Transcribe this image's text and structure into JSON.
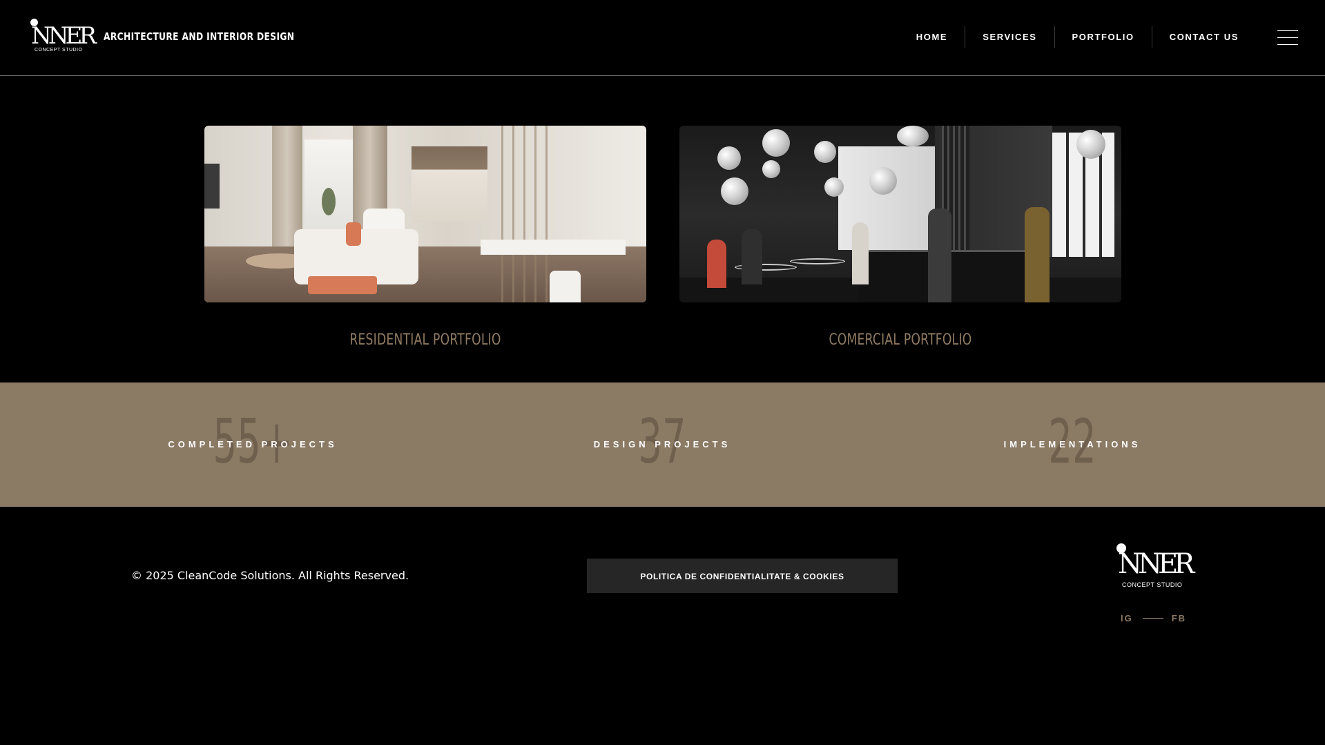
{
  "header": {
    "logo": {
      "wordmark": "NNER",
      "subtitle": "CONCEPT STUDIO"
    },
    "tagline": "ARCHITECTURE AND INTERIOR DESIGN",
    "nav": [
      "HOME",
      "SERVICES",
      "PORTFOLIO",
      "CONTACT US"
    ],
    "menu_icon": "hamburger-icon"
  },
  "portfolio": {
    "cards": [
      {
        "caption": "RESIDENTIAL PORTFOLIO",
        "image": "residential-interior-photo"
      },
      {
        "caption": "COMERCIAL PORTFOLIO",
        "image": "commercial-cafe-interior-photo"
      }
    ]
  },
  "stats": {
    "background_color": "#8b7a64",
    "items": [
      {
        "number": "55+",
        "label": "COMPLETED PROJECTS"
      },
      {
        "number": "37",
        "label": "DESIGN PROJECTS"
      },
      {
        "number": "22",
        "label": "IMPLEMENTATIONS"
      }
    ]
  },
  "footer": {
    "copyright": "© 2025 CleanCode Solutions. All Rights Reserved.",
    "policy_button": "POLITICA DE CONFIDENTIALITATE & COOKIES",
    "logo": {
      "wordmark": "NNER",
      "subtitle": "CONCEPT STUDIO"
    },
    "social": [
      "IG",
      "FB"
    ]
  },
  "colors": {
    "background": "#000000",
    "accent": "#8b7a64",
    "caption": "#8f7b63"
  }
}
